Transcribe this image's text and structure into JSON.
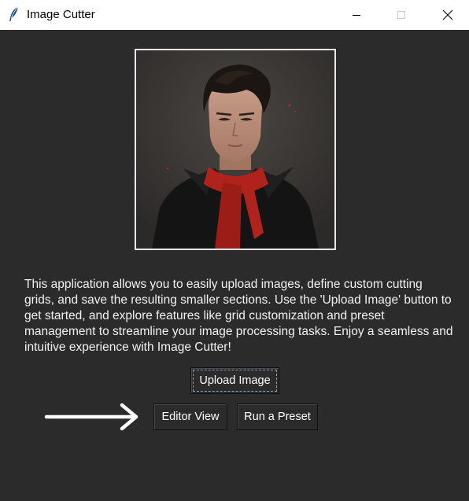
{
  "window": {
    "title": "Image Cutter"
  },
  "main": {
    "description": "This application allows you to easily upload images, define custom cutting grids, and save the resulting smaller sections. Use the 'Upload Image' button to get started, and explore features like grid customization and preset management to streamline your image processing tasks. Enjoy a seamless and intuitive experience with Image Cutter!",
    "upload_button": "Upload Image",
    "editor_button": "Editor View",
    "preset_button": "Run a Preset"
  },
  "icons": {
    "app": "feather-icon",
    "minimize": "minimize-icon",
    "maximize": "maximize-icon",
    "close": "close-icon",
    "arrow": "arrow-right-icon"
  },
  "colors": {
    "background": "#2b2b2b",
    "titlebar": "#ffffff",
    "text": "#f2f2f2",
    "scarf": "#b0221c"
  }
}
